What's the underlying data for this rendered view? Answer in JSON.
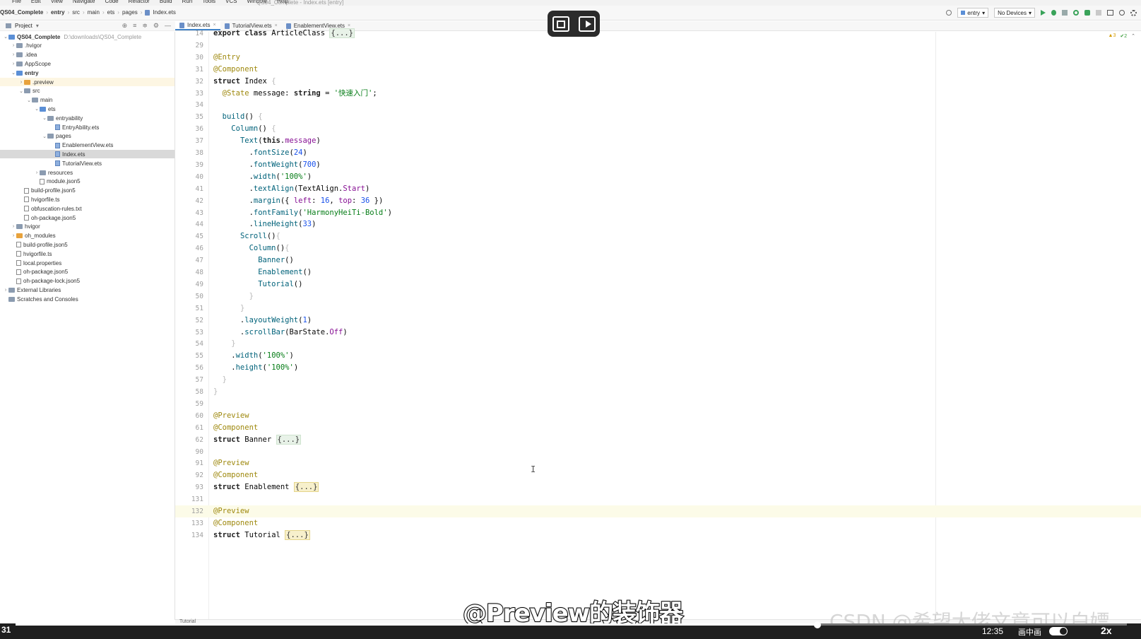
{
  "menubar": {
    "items": [
      "File",
      "Edit",
      "View",
      "Navigate",
      "Code",
      "Refactor",
      "Build",
      "Run",
      "Tools",
      "VCS",
      "Window",
      "Help"
    ],
    "window_title": "QS04_Complete - Index.ets [entry]"
  },
  "breadcrumbs": [
    "QS04_Complete",
    "entry",
    "src",
    "main",
    "ets",
    "pages",
    "Index.ets"
  ],
  "toolbar": {
    "module_combo": "entry",
    "device_combo": "No Devices"
  },
  "project_panel": {
    "label": "Project"
  },
  "tabs": [
    {
      "label": "Index.ets",
      "active": true
    },
    {
      "label": "TutorialView.ets",
      "active": false
    },
    {
      "label": "EnablementView.ets",
      "active": false
    }
  ],
  "tree": [
    {
      "label": "QS04_Complete",
      "hint": "D:\\downloads\\QS04_Complete",
      "depth": 0,
      "arrow": "v",
      "kind": "folder-blue",
      "bold": true
    },
    {
      "label": ".hvigor",
      "depth": 1,
      "arrow": ">",
      "kind": "folder"
    },
    {
      "label": ".idea",
      "depth": 1,
      "arrow": ">",
      "kind": "folder"
    },
    {
      "label": "AppScope",
      "depth": 1,
      "arrow": ">",
      "kind": "folder"
    },
    {
      "label": "entry",
      "depth": 1,
      "arrow": "v",
      "kind": "folder-blue",
      "bold": true
    },
    {
      "label": ".preview",
      "depth": 2,
      "arrow": ">",
      "kind": "folder-orange",
      "preview": true
    },
    {
      "label": "src",
      "depth": 2,
      "arrow": "v",
      "kind": "folder"
    },
    {
      "label": "main",
      "depth": 3,
      "arrow": "v",
      "kind": "folder"
    },
    {
      "label": "ets",
      "depth": 4,
      "arrow": "v",
      "kind": "folder-blue"
    },
    {
      "label": "entryability",
      "depth": 5,
      "arrow": "v",
      "kind": "folder"
    },
    {
      "label": "EntryAbility.ets",
      "depth": 6,
      "arrow": "",
      "kind": "ets"
    },
    {
      "label": "pages",
      "depth": 5,
      "arrow": "v",
      "kind": "folder"
    },
    {
      "label": "EnablementView.ets",
      "depth": 6,
      "arrow": "",
      "kind": "ets"
    },
    {
      "label": "Index.ets",
      "depth": 6,
      "arrow": "",
      "kind": "ets",
      "selected": true
    },
    {
      "label": "TutorialView.ets",
      "depth": 6,
      "arrow": "",
      "kind": "ets"
    },
    {
      "label": "resources",
      "depth": 4,
      "arrow": ">",
      "kind": "folder"
    },
    {
      "label": "module.json5",
      "depth": 4,
      "arrow": "",
      "kind": "file"
    },
    {
      "label": "build-profile.json5",
      "depth": 2,
      "arrow": "",
      "kind": "file"
    },
    {
      "label": "hvigorfile.ts",
      "depth": 2,
      "arrow": "",
      "kind": "file"
    },
    {
      "label": "obfuscation-rules.txt",
      "depth": 2,
      "arrow": "",
      "kind": "file"
    },
    {
      "label": "oh-package.json5",
      "depth": 2,
      "arrow": "",
      "kind": "file"
    },
    {
      "label": "hvigor",
      "depth": 1,
      "arrow": ">",
      "kind": "folder"
    },
    {
      "label": "oh_modules",
      "depth": 1,
      "arrow": ">",
      "kind": "folder-orange"
    },
    {
      "label": "build-profile.json5",
      "depth": 1,
      "arrow": "",
      "kind": "file"
    },
    {
      "label": "hvigorfile.ts",
      "depth": 1,
      "arrow": "",
      "kind": "file"
    },
    {
      "label": "local.properties",
      "depth": 1,
      "arrow": "",
      "kind": "file"
    },
    {
      "label": "oh-package.json5",
      "depth": 1,
      "arrow": "",
      "kind": "file"
    },
    {
      "label": "oh-package-lock.json5",
      "depth": 1,
      "arrow": "",
      "kind": "file"
    },
    {
      "label": "External Libraries",
      "depth": 0,
      "arrow": ">",
      "kind": "folder"
    },
    {
      "label": "Scratches and Consoles",
      "depth": 0,
      "arrow": "",
      "kind": "folder"
    }
  ],
  "editor": {
    "warnings": "▲3",
    "checks": "✔2",
    "lines": [
      {
        "n": "14",
        "html": "<span class='kwb'>export class</span> <span class='struct'>ArticleClass</span> <span class='fold'>{...}</span>"
      },
      {
        "n": "29",
        "html": ""
      },
      {
        "n": "30",
        "html": "<span class='ann'>@Entry</span>"
      },
      {
        "n": "31",
        "html": "<span class='ann'>@Component</span>"
      },
      {
        "n": "32",
        "html": "<span class='kwb'>struct</span> Index <span class='br'>{</span>"
      },
      {
        "n": "33",
        "html": "  <span class='ann'>@State</span> message: <span class='kwb'>string</span> = <span class='str'>'快速入门'</span>;"
      },
      {
        "n": "34",
        "html": ""
      },
      {
        "n": "35",
        "html": "  <span class='fn'>build</span>() <span class='br'>{</span>"
      },
      {
        "n": "36",
        "html": "    <span class='comp'>Column</span>() <span class='br'>{</span>"
      },
      {
        "n": "37",
        "html": "      <span class='comp'>Text</span>(<span class='kwb'>this</span>.<span class='field'>message</span>)"
      },
      {
        "n": "38",
        "html": "        .<span class='fn'>fontSize</span>(<span class='num'>24</span>)"
      },
      {
        "n": "39",
        "html": "        .<span class='fn'>fontWeight</span>(<span class='num'>700</span>)"
      },
      {
        "n": "40",
        "html": "        .<span class='fn'>width</span>(<span class='str'>'100%'</span>)"
      },
      {
        "n": "41",
        "html": "        .<span class='fn'>textAlign</span>(TextAlign.<span class='prop'>Start</span>)"
      },
      {
        "n": "42",
        "html": "        .<span class='fn'>margin</span>({ <span class='prop'>left</span>: <span class='num'>16</span>, <span class='prop'>top</span>: <span class='num'>36</span> })"
      },
      {
        "n": "43",
        "html": "        .<span class='fn'>fontFamily</span>(<span class='str'>'HarmonyHeiTi-Bold'</span>)"
      },
      {
        "n": "44",
        "html": "        .<span class='fn'>lineHeight</span>(<span class='num'>33</span>)"
      },
      {
        "n": "45",
        "html": "      <span class='comp'>Scroll</span>()<span class='br'>{</span>"
      },
      {
        "n": "46",
        "html": "        <span class='comp'>Column</span>()<span class='br'>{</span>"
      },
      {
        "n": "47",
        "html": "          <span class='comp'>Banner</span>()"
      },
      {
        "n": "48",
        "html": "          <span class='comp'>Enablement</span>()"
      },
      {
        "n": "49",
        "html": "          <span class='comp'>Tutorial</span>()"
      },
      {
        "n": "50",
        "html": "        <span class='br'>}</span>"
      },
      {
        "n": "51",
        "html": "      <span class='br'>}</span>"
      },
      {
        "n": "52",
        "html": "      .<span class='fn'>layoutWeight</span>(<span class='num'>1</span>)"
      },
      {
        "n": "53",
        "html": "      .<span class='fn'>scrollBar</span>(BarState.<span class='prop'>Off</span>)"
      },
      {
        "n": "54",
        "html": "    <span class='br'>}</span>"
      },
      {
        "n": "55",
        "html": "    .<span class='fn'>width</span>(<span class='str'>'100%'</span>)"
      },
      {
        "n": "56",
        "html": "    .<span class='fn'>height</span>(<span class='str'>'100%'</span>)"
      },
      {
        "n": "57",
        "html": "  <span class='br'>}</span>"
      },
      {
        "n": "58",
        "html": "<span class='br'>}</span>"
      },
      {
        "n": "59",
        "html": ""
      },
      {
        "n": "60",
        "html": "<span class='ann'>@Preview</span>"
      },
      {
        "n": "61",
        "html": "<span class='ann'>@Component</span>"
      },
      {
        "n": "62",
        "html": "<span class='kwb'>struct</span> Banner <span class='fold'>{...}</span>"
      },
      {
        "n": "90",
        "html": ""
      },
      {
        "n": "91",
        "html": "<span class='ann'>@Preview</span>"
      },
      {
        "n": "92",
        "html": "<span class='ann'>@Component</span>"
      },
      {
        "n": "93",
        "html": "<span class='kwb'>struct</span> Enablement <span class='fold y'>{...}</span>"
      },
      {
        "n": "131",
        "html": ""
      },
      {
        "n": "132",
        "html": "<span class='ann'>@Preview</span>",
        "hl": true
      },
      {
        "n": "133",
        "html": "<span class='ann'>@Component</span>"
      },
      {
        "n": "134",
        "html": "<span class='kwb'>struct</span> Tutorial <span class='fold y'>{...}</span>"
      }
    ]
  },
  "bottom_tab": "Tutorial",
  "video": {
    "left_text": "31",
    "time": "12:35",
    "pip_label": "画中画",
    "speed": "2x"
  },
  "subtitle": "@Preview的装饰器",
  "watermark": "CSDN @希望大佬文章可以白嫖"
}
